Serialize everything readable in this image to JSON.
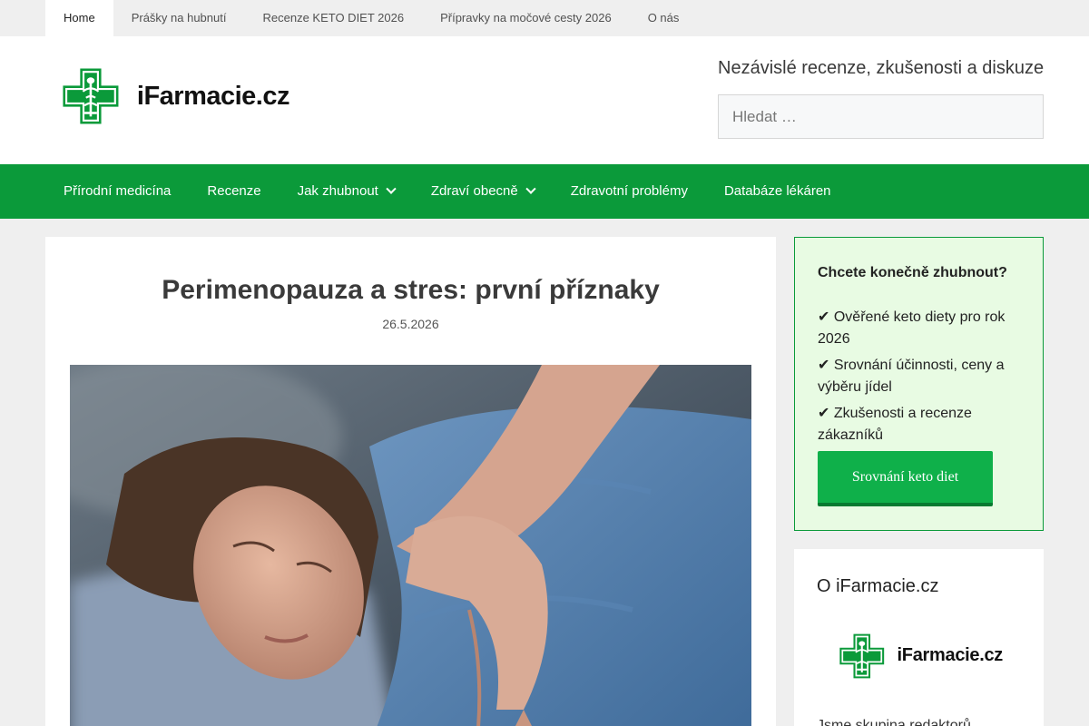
{
  "top_nav": {
    "items": [
      "Home",
      "Prášky na hubnutí",
      "Recenze KETO DIET 2026",
      "Přípravky na močové cesty 2026",
      "O nás"
    ]
  },
  "header": {
    "logo_text": "iFarmacie.cz",
    "tagline": "Nezávislé recenze, zkušenosti a diskuze",
    "search_placeholder": "Hledat …",
    "search_icon": "none"
  },
  "main_nav": {
    "items": [
      {
        "label": "Přírodní medicína"
      },
      {
        "label": "Recenze"
      },
      {
        "label": "Jak zhubnout",
        "icon": "chevron-down-icon"
      },
      {
        "label": "Zdraví obecně",
        "icon": "chevron-down-icon"
      },
      {
        "label": "Zdravotní problémy"
      },
      {
        "label": "Databáze lékáren"
      }
    ]
  },
  "article": {
    "title": "Perimenopauza a stres: první příznaky",
    "date": "26.5.2026"
  },
  "promo": {
    "heading": "Chcete konečně zhubnout?",
    "points": [
      "✔ Ověřené keto diety pro rok 2026",
      "✔ Srovnání účinnosti, ceny a výběru jídel",
      "✔ Zkušenosti a recenze zákazníků"
    ],
    "button_label": "Srovnání keto diet"
  },
  "about": {
    "heading": "O iFarmacie.cz",
    "logo_text": "iFarmacie.cz",
    "text": "Jsme skupina redaktorů"
  },
  "colors": {
    "brand_green": "#0b9a3a",
    "promo_bg": "#e8fbe3",
    "button_green": "#0fb04a"
  }
}
